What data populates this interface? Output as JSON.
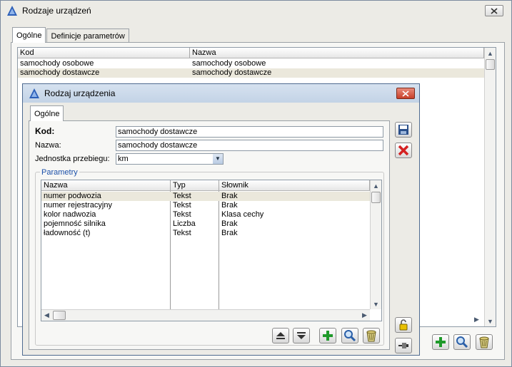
{
  "outer": {
    "title": "Rodzaje urządzeń",
    "tabs": [
      {
        "label": "Ogólne"
      },
      {
        "label": "Definicje parametrów"
      }
    ],
    "table": {
      "columns": [
        "Kod",
        "Nazwa"
      ],
      "rows": [
        [
          "samochody osobowe",
          "samochody osobowe"
        ],
        [
          "samochody dostawcze",
          "samochody dostawcze"
        ]
      ],
      "selected_row": 1
    },
    "icons": [
      "plus-icon",
      "search-icon",
      "trash-icon"
    ]
  },
  "dialog": {
    "title": "Rodzaj urządzenia",
    "tab": "Ogólne",
    "kod_label": "Kod:",
    "kod_value": "samochody dostawcze",
    "nazwa_label": "Nazwa:",
    "nazwa_value": "samochody dostawcze",
    "jednostka_label": "Jednostka przebiegu:",
    "jednostka_value": "km",
    "group_label": "Parametry",
    "params": {
      "columns": [
        "Nazwa",
        "Typ",
        "Słownik"
      ],
      "rows": [
        [
          "numer podwozia",
          "Tekst",
          "Brak"
        ],
        [
          "numer rejestracyjny",
          "Tekst",
          "Brak"
        ],
        [
          "kolor nadwozia",
          "Tekst",
          "Klasa cechy"
        ],
        [
          "pojemność silnika",
          "Liczba",
          "Brak"
        ],
        [
          "ładowność (t)",
          "Tekst",
          "Brak"
        ]
      ],
      "selected_row": 0
    },
    "icons": [
      "save-icon",
      "delete-icon",
      "move-up-icon",
      "move-down-icon",
      "plus-icon",
      "search-icon",
      "trash-icon",
      "lock-icon",
      "pin-icon"
    ],
    "colors": {
      "accent_green": "#1f9a2a",
      "delete_red": "#d42020",
      "title_logo": "#2c5fb8"
    }
  }
}
